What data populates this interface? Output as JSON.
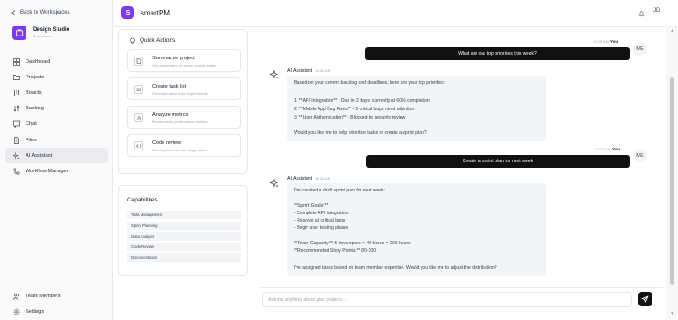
{
  "sidebar": {
    "back_label": "Back to Workspaces",
    "workspace": {
      "name": "Design Studio",
      "members": "8 members"
    },
    "nav": [
      {
        "label": "Dashboard",
        "icon": "dashboard-icon"
      },
      {
        "label": "Projects",
        "icon": "folder-icon"
      },
      {
        "label": "Boards",
        "icon": "board-icon"
      },
      {
        "label": "Backlog",
        "icon": "backlog-icon"
      },
      {
        "label": "Chat",
        "icon": "chat-icon"
      },
      {
        "label": "Files",
        "icon": "file-icon"
      },
      {
        "label": "AI Assistant",
        "icon": "sparkle-icon",
        "active": true
      },
      {
        "label": "Workflow Manager",
        "icon": "workflow-icon"
      }
    ],
    "bottom_nav": [
      {
        "label": "Team Members",
        "icon": "users-icon"
      },
      {
        "label": "Settings",
        "icon": "gear-icon"
      }
    ]
  },
  "header": {
    "logo_letter": "S",
    "app_name": "smartPM",
    "avatar_initials": "JD"
  },
  "quick_actions": {
    "title": "Quick Actions",
    "items": [
      {
        "title": "Summarize project",
        "desc": "Get a summary of current project status",
        "icon": "document-icon"
      },
      {
        "title": "Create task list",
        "desc": "Generate tasks from requirements",
        "icon": "list-icon"
      },
      {
        "title": "Analyze metrics",
        "desc": "Review team performance metrics",
        "icon": "chart-icon"
      },
      {
        "title": "Code review",
        "desc": "Get AI-powered code suggestions",
        "icon": "code-icon"
      }
    ]
  },
  "capabilities": {
    "title": "Capabilities",
    "items": [
      "Task Management",
      "Sprint Planning",
      "Data Analysis",
      "Code Review",
      "Documentation"
    ]
  },
  "messages": {
    "user1": {
      "time": "10:30 AM",
      "sender": "You",
      "initials": "ME",
      "text": "What are our top priorities this week?"
    },
    "ai1": {
      "sender": "AI Assistant",
      "time": "10:30 AM",
      "lines": [
        "Based on your current backlog and deadlines, here are your top priorities:",
        "",
        "1. **API Integration** - Due in 2 days, currently at 60% completion",
        "2. **Mobile App Bug Fixes** - 5 critical bugs need attention",
        "3. **User Authentication** - Blocked by security review",
        "",
        "Would you like me to help prioritize tasks or create a sprint plan?"
      ]
    },
    "user2": {
      "time": "10:32 AM",
      "sender": "You",
      "initials": "ME",
      "text": "Create a sprint plan for next week"
    },
    "ai2": {
      "sender": "AI Assistant",
      "time": "10:32 AM",
      "lines": [
        "I've created a draft sprint plan for next week:",
        "",
        "**Sprint Goals:**",
        "- Complete API integration",
        "- Resolve all critical bugs",
        "- Begin user testing phase",
        "",
        "**Team Capacity:** 5 developers × 40 hours = 200 hours",
        "**Recommended Story Points:** 80-100",
        "",
        "I've assigned tasks based on team member expertise. Would you like me to adjust the distribution?"
      ]
    }
  },
  "input": {
    "placeholder": "Ask me anything about your projects...",
    "value": ""
  },
  "colors": {
    "accent": "#7c3aed",
    "dark": "#111111",
    "bubble": "#f3f4f6"
  }
}
